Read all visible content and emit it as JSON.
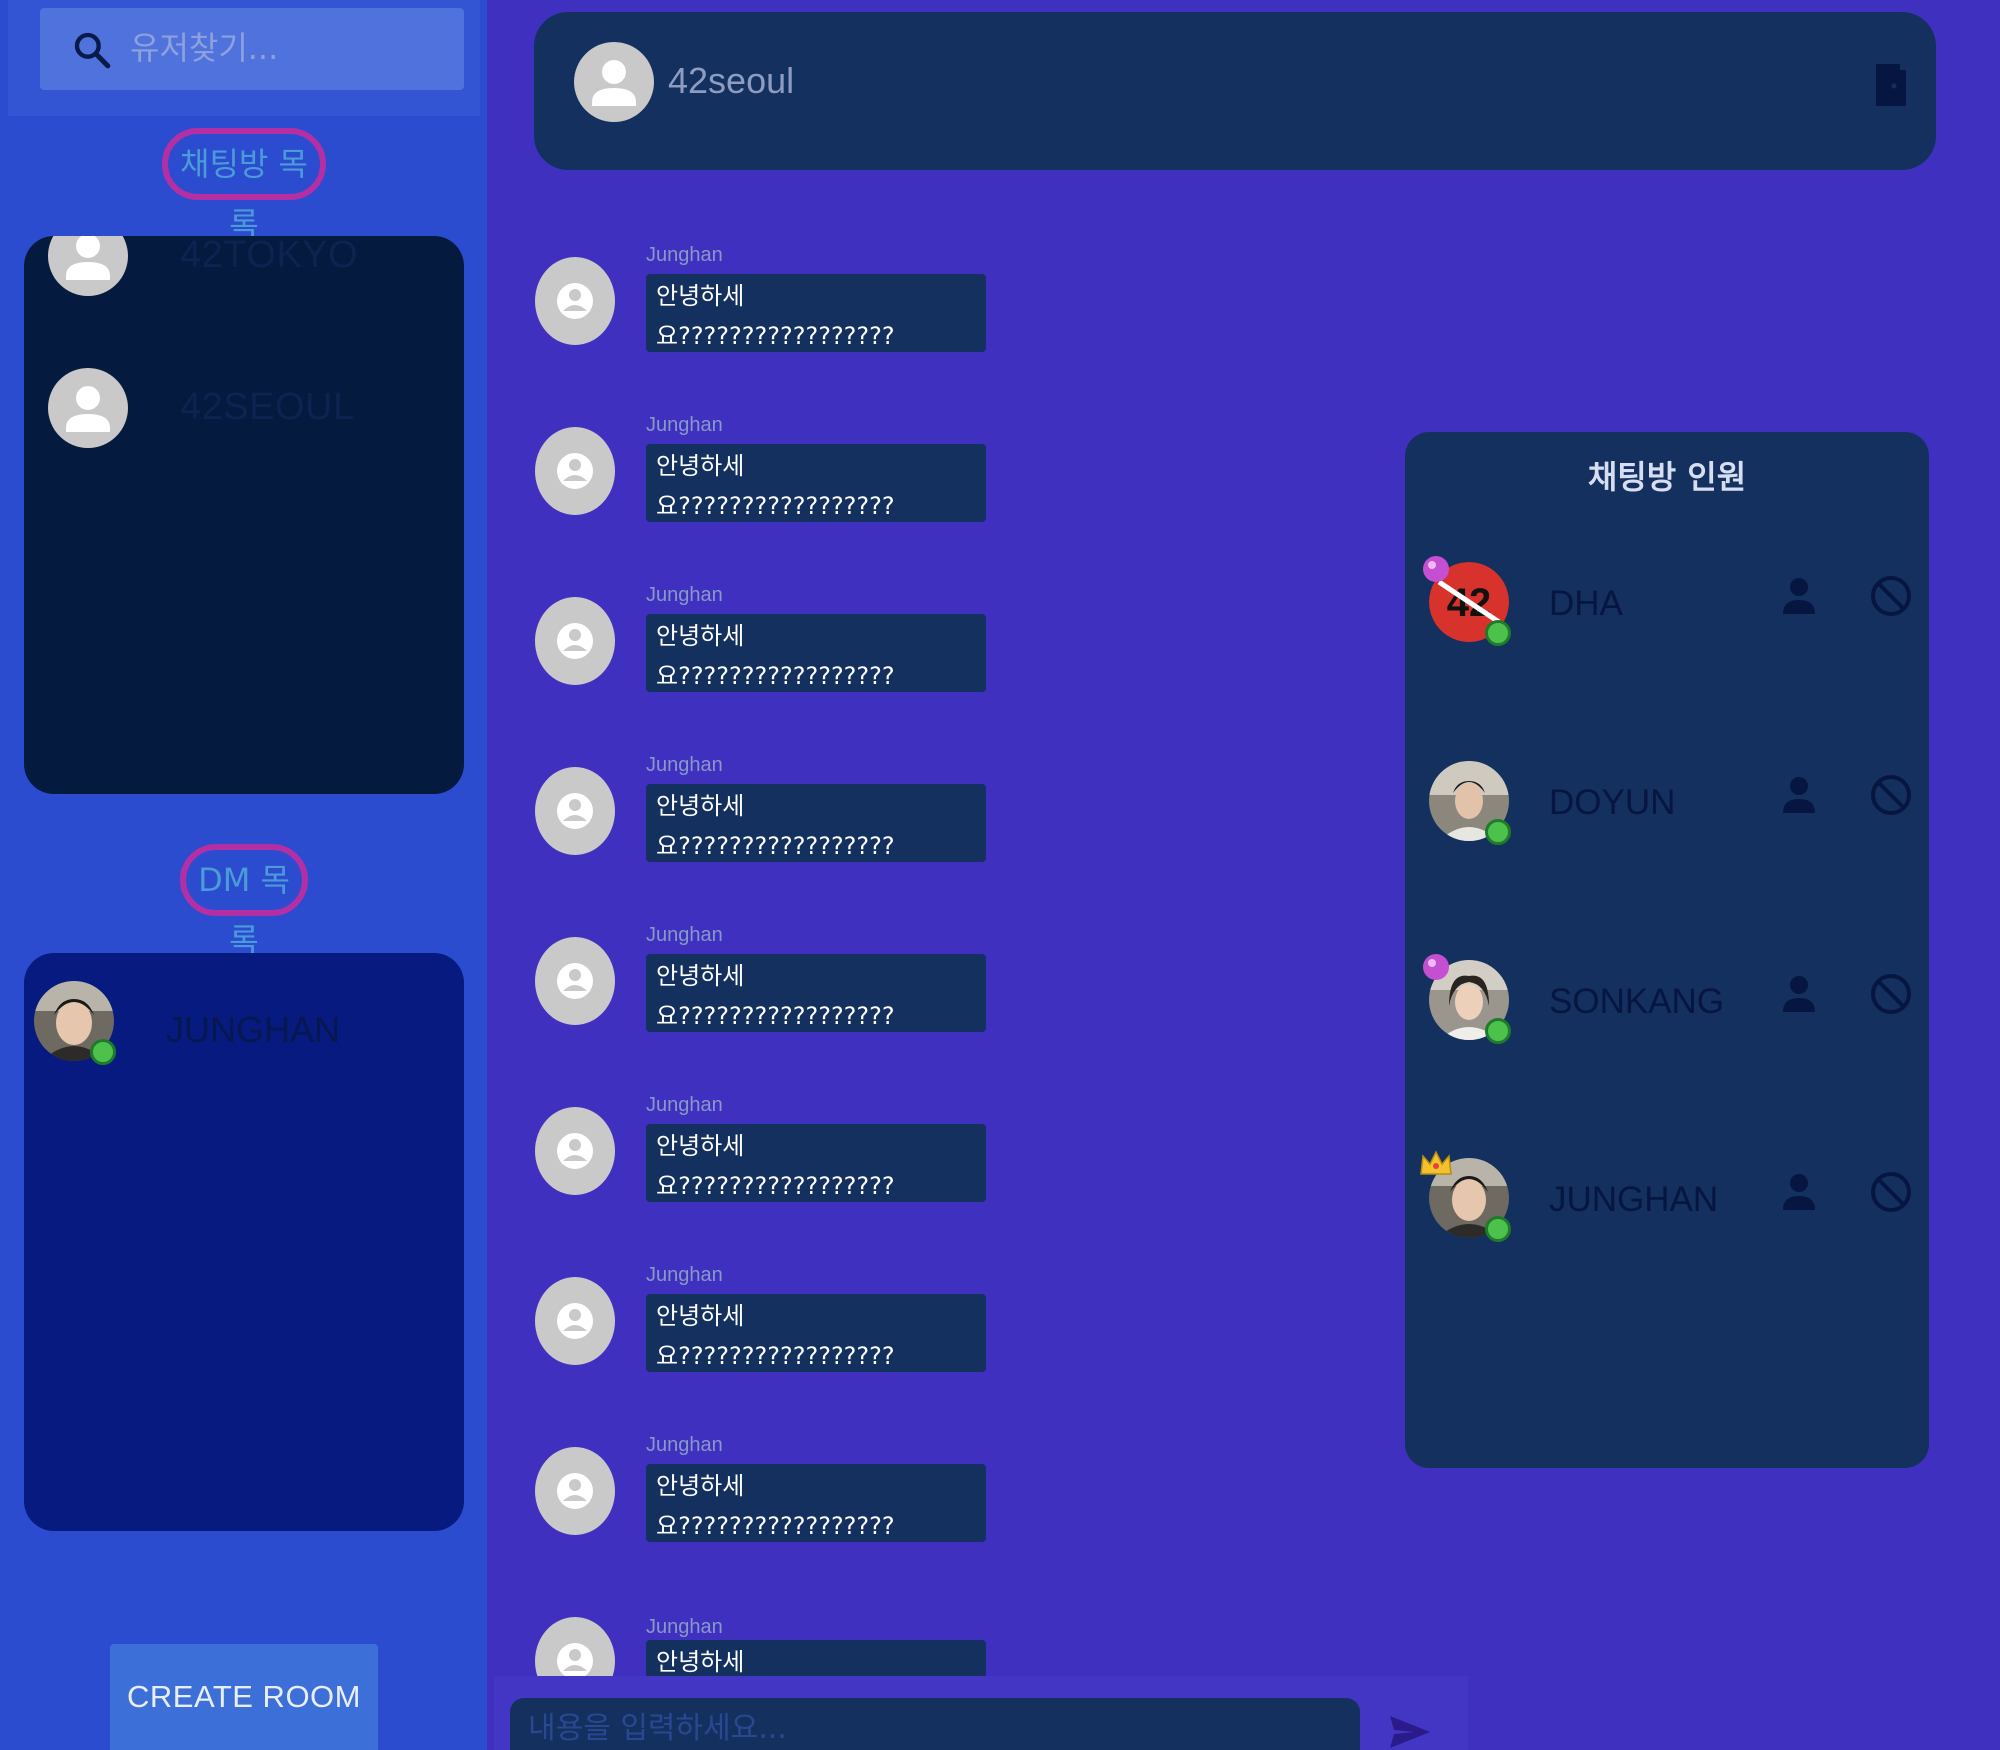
{
  "search": {
    "placeholder": "유저찾기..."
  },
  "sidebar": {
    "rooms_label": "채팅방 목록",
    "dm_label": "DM 목록",
    "rooms": [
      {
        "name": "42TOKYO"
      },
      {
        "name": "42SEOUL"
      }
    ],
    "dms": [
      {
        "name": "JUNGHAN",
        "status": "online"
      }
    ],
    "create_room_label": "CREATE ROOM"
  },
  "chat": {
    "room_title": "42seoul",
    "messages": [
      {
        "sender": "Junghan",
        "text": "안녕하세요?????????????????"
      },
      {
        "sender": "Junghan",
        "text": "안녕하세요?????????????????"
      },
      {
        "sender": "Junghan",
        "text": "안녕하세요?????????????????"
      },
      {
        "sender": "Junghan",
        "text": "안녕하세요?????????????????"
      },
      {
        "sender": "Junghan",
        "text": "안녕하세요?????????????????"
      },
      {
        "sender": "Junghan",
        "text": "안녕하세요?????????????????"
      },
      {
        "sender": "Junghan",
        "text": "안녕하세요?????????????????"
      },
      {
        "sender": "Junghan",
        "text": "안녕하세요?????????????????"
      },
      {
        "sender": "Junghan",
        "text": "안녕하세"
      }
    ],
    "input_placeholder": "내용을 입력하세요..."
  },
  "members": {
    "heading": "채팅방 인원",
    "list": [
      {
        "name": "DHA",
        "badge": "admin-badge",
        "status": "online"
      },
      {
        "name": "DOYUN",
        "badge": "",
        "status": "online"
      },
      {
        "name": "SONKANG",
        "badge": "admin-badge",
        "status": "online"
      },
      {
        "name": "JUNGHAN",
        "badge": "owner-crown",
        "status": "online"
      }
    ]
  },
  "colors": {
    "background": "#4030c0",
    "sidebar": "#2b4ccf",
    "panel_dark": "#13305f",
    "online": "#4cc24c",
    "label_border": "#b52fa4"
  }
}
